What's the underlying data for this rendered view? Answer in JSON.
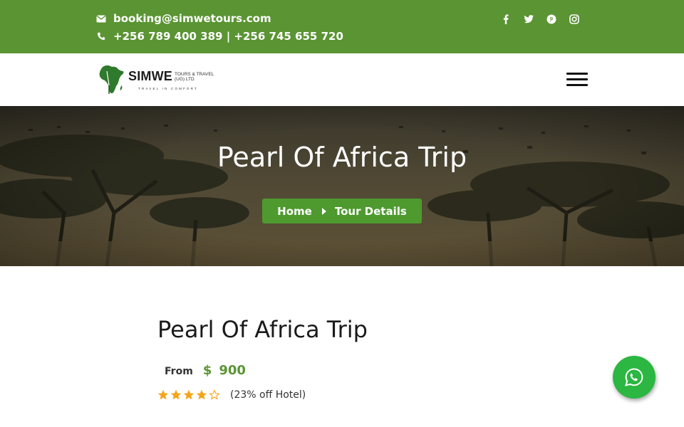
{
  "topbar": {
    "email": "booking@simwetours.com",
    "phone": "+256 789 400 389 | +256 745 655 720",
    "socials": [
      "facebook-icon",
      "twitter-icon",
      "pinterest-icon",
      "instagram-icon"
    ],
    "bg_color": "#5a9433"
  },
  "logo": {
    "name": "SIMWE",
    "sub": "TOURS & TRAVEL (UG) LTD",
    "tagline": "TRAVEL IN COMFORT"
  },
  "hero": {
    "title": "Pearl Of Africa Trip",
    "breadcrumb": {
      "home": "Home",
      "current": "Tour Details"
    }
  },
  "tour": {
    "title": "Pearl Of Africa Trip",
    "price_prefix": "From",
    "currency": "$",
    "price": "900",
    "rating": 4,
    "rating_max": 5,
    "note": "(23% off Hotel)"
  },
  "colors": {
    "accent": "#5a9433",
    "star": "#f4a51c",
    "whatsapp": "#2bb741"
  }
}
